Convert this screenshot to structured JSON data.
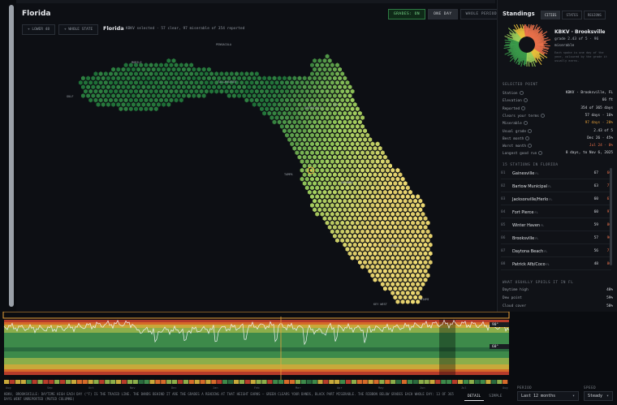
{
  "header": {
    "title": "Florida",
    "grade_pills": [
      "GRADES: ON",
      "ONE DAY",
      "WHOLE PERIOD"
    ],
    "controls": [
      "+ LOWER 48",
      "+ WHOLE STATE"
    ],
    "region": "Florida",
    "subtitle": "KBKV selected · 57 clear, 97 miserable of 354 reported"
  },
  "map": {
    "city_labels": [
      "MOBILE",
      "PENSACOLA",
      "GULF",
      "TALLAHASSEE",
      "ORLANDO",
      "TAMPA",
      "FT MYERS",
      "MIAMI",
      "KEY WEST",
      "JAX",
      "GAINESVILLE"
    ]
  },
  "right": {
    "title": "Standings",
    "tabs": [
      "CITIES",
      "STATES",
      "REGIONS"
    ],
    "station_name": "KBKV · Brooksville",
    "station_grade": "grade 2.43 of 5 · 96 miserable",
    "station_note": "Each spoke is one day of the year, coloured by the grade it usually earns.",
    "selected_header": "SELECTED POINT",
    "kv": [
      {
        "k": "Station",
        "v": "KBKV · Brooksville, FL",
        "t": ""
      },
      {
        "k": "Elevation",
        "v": "66 ft",
        "t": ""
      },
      {
        "k": "Reported",
        "v": "354 of 365 days",
        "t": ""
      },
      {
        "k": "Clears your terms",
        "v": "57 days · 16%",
        "t": ""
      },
      {
        "k": "Miserable",
        "v": "97 days · 28%",
        "t": "warn"
      },
      {
        "k": "Usual grade",
        "v": "2.43 of 5",
        "t": ""
      },
      {
        "k": "Best month",
        "v": "Dec 26 · 45%",
        "t": ""
      },
      {
        "k": "Worst month",
        "v": "Jul 24 · 0%",
        "t": "bad"
      },
      {
        "k": "Longest good run",
        "v": "8 days, to Nov 6, 2025",
        "t": ""
      }
    ],
    "stations_header": "15 STATIONS IN FLORIDA",
    "stations": [
      {
        "n": "01",
        "name": "Gainesville",
        "st": "FL",
        "a": "67",
        "b": "66"
      },
      {
        "n": "02",
        "name": "Bartow Municipal",
        "st": "FL",
        "a": "63",
        "b": "77"
      },
      {
        "n": "03",
        "name": "Jacksonville/Herlo",
        "st": "FL",
        "a": "60",
        "b": "61"
      },
      {
        "n": "04",
        "name": "Fort Pierce",
        "st": "FL",
        "a": "60",
        "b": "97"
      },
      {
        "n": "05",
        "name": "Winter Haven",
        "st": "FL",
        "a": "59",
        "b": "86"
      },
      {
        "n": "06",
        "name": "Brooksville",
        "st": "FL",
        "a": "57",
        "b": "96"
      },
      {
        "n": "07",
        "name": "Daytona Beach",
        "st": "FL",
        "a": "56",
        "b": "71"
      },
      {
        "n": "08",
        "name": "Patrick Afb/Coco",
        "st": "FL",
        "a": "48",
        "b": "86"
      }
    ],
    "spoils_header": "WHAT USUALLY SPOILS IT IN FL",
    "spoils": [
      {
        "k": "Daytime high",
        "v": "48%"
      },
      {
        "k": "Dew point",
        "v": "59%"
      },
      {
        "k": "Cloud cover",
        "v": "58%"
      }
    ]
  },
  "timeline": {
    "months": [
      "Aug",
      "Sep",
      "Oct",
      "Nov",
      "Dec",
      "Jan",
      "Feb",
      "Mar",
      "Apr",
      "May",
      "Jun",
      "Jul",
      "Aug"
    ],
    "band_labels": [
      "90°",
      "60°"
    ],
    "footer_text": "KBKV, BROOKSVILLE: DAYTIME HIGH EACH DAY (°F) IS THE TRACED LINE. THE BANDS BEHIND IT ARE THE GRADES A READING AT THAT HEIGHT EARNS — GREEN CLEARS YOUR BANDS, BLACK PART MISERABLE. THE RIBBON BELOW GRADES EACH WHOLE DAY: 13 OF 365 DAYS WENT UNREPORTED (MUTED COLUMNS)",
    "view_tabs": [
      "DETAIL",
      "SIMPLE"
    ],
    "period_label": "PERIOD",
    "period_value": "Last 12 months",
    "speed_label": "SPEED",
    "speed_value": "Steady"
  },
  "colors": {
    "accent": "#e9a23b",
    "good": "#2e7a43",
    "bad": "#e8704a"
  }
}
